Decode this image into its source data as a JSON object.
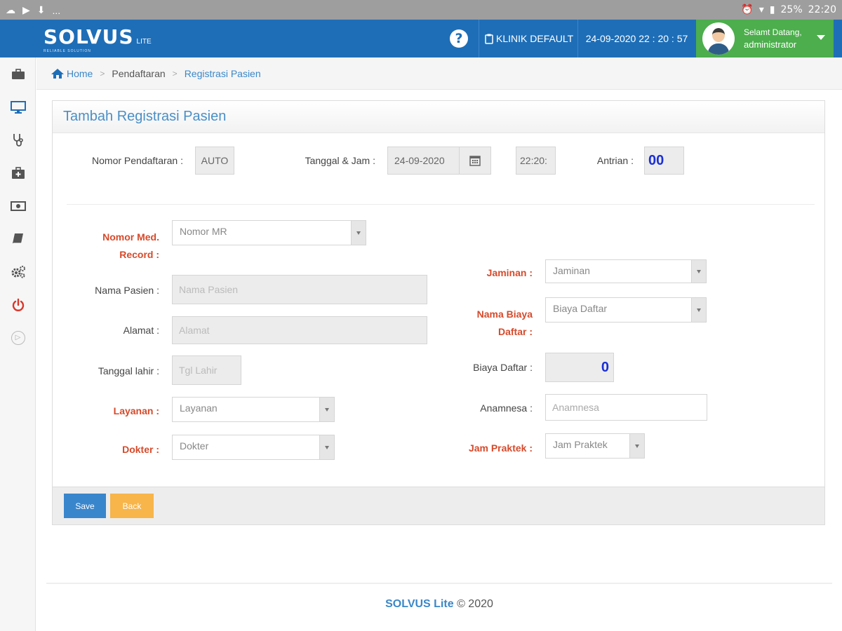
{
  "statusbar": {
    "left_icons": [
      "cloud-icon",
      "play-icon",
      "download-icon"
    ],
    "more": "...",
    "right": {
      "battery": "25%",
      "time": "22:20"
    }
  },
  "header": {
    "brand": "SOLVUS",
    "brand_suffix": "LITE",
    "tagline": "RELIABLE SOLUTION",
    "help": "?",
    "clinic": "KLINIK DEFAULT",
    "datetime": "24-09-2020 22 : 20 : 57",
    "user": {
      "greeting": "Selamt Datang,",
      "name": "administrator"
    }
  },
  "sidebar": {
    "items": [
      {
        "name": "briefcase",
        "icon": "briefcase-icon"
      },
      {
        "name": "monitor",
        "icon": "monitor-icon"
      },
      {
        "name": "stethoscope",
        "icon": "stethoscope-icon"
      },
      {
        "name": "medical-kit",
        "icon": "medkit-icon"
      },
      {
        "name": "money",
        "icon": "money-icon"
      },
      {
        "name": "book",
        "icon": "book-icon"
      },
      {
        "name": "settings",
        "icon": "cogs-icon"
      },
      {
        "name": "logout",
        "icon": "power-icon"
      },
      {
        "name": "expand",
        "icon": "chevron-right-icon"
      }
    ]
  },
  "breadcrumb": {
    "home": "Home",
    "level1": "Pendaftaran",
    "level2": "Registrasi Pasien"
  },
  "panel": {
    "title": "Tambah Registrasi Pasien"
  },
  "form": {
    "nomor_pendaftaran": {
      "label": "Nomor Pendaftaran :",
      "value": "AUTO"
    },
    "tanggal_jam": {
      "label": "Tanggal & Jam :",
      "date": "24-09-2020",
      "time": "22:20:"
    },
    "antrian": {
      "label": "Antrian :",
      "value": "00"
    },
    "nomor_mr": {
      "label_line1": "Nomor Med.",
      "label_line2": "Record :",
      "placeholder": "Nomor MR"
    },
    "nama_pasien": {
      "label": "Nama Pasien :",
      "placeholder": "Nama Pasien"
    },
    "alamat": {
      "label": "Alamat :",
      "placeholder": "Alamat"
    },
    "tanggal_lahir": {
      "label": "Tanggal lahir :",
      "placeholder": "Tgl Lahir"
    },
    "layanan": {
      "label": "Layanan :",
      "placeholder": "Layanan"
    },
    "dokter": {
      "label": "Dokter :",
      "placeholder": "Dokter"
    },
    "jaminan": {
      "label": "Jaminan :",
      "placeholder": "Jaminan"
    },
    "nama_biaya": {
      "label_line1": "Nama Biaya",
      "label_line2": "Daftar :",
      "placeholder": "Biaya Daftar"
    },
    "biaya_daftar": {
      "label": "Biaya Daftar :",
      "value": "0"
    },
    "anamnesa": {
      "label": "Anamnesa :",
      "placeholder": "Anamnesa"
    },
    "jam_praktek": {
      "label": "Jam Praktek :",
      "placeholder": "Jam Praktek"
    }
  },
  "actions": {
    "save": "Save",
    "back": "Back"
  },
  "footer": {
    "brand": "SOLVUS Lite",
    "copyright": "© 2020"
  },
  "colors": {
    "primary": "#1e6eb7",
    "user_green": "#4cae4c",
    "required_label": "#d64a2b",
    "save_button": "#3a86cc",
    "back_button": "#f7b54a",
    "antrian_value": "#1a2fd6"
  }
}
